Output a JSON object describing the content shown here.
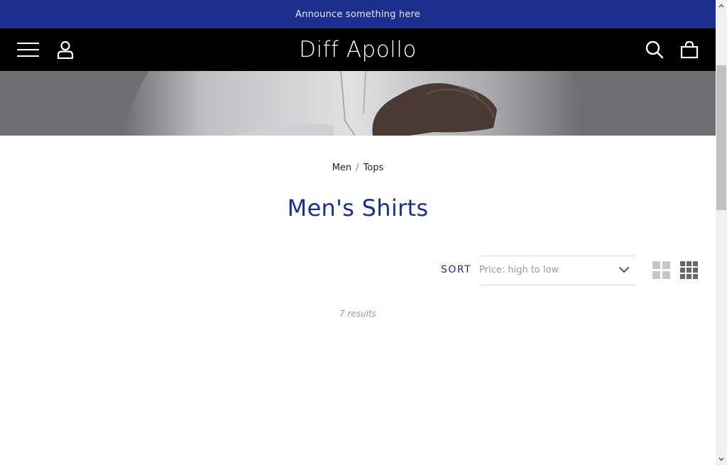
{
  "announcement": "Announce something here",
  "header": {
    "brand": "Diff Apollo",
    "icons": [
      "hamburger-menu-icon",
      "account-icon",
      "search-icon",
      "shopping-bag-icon"
    ]
  },
  "breadcrumb": {
    "items": [
      "Men",
      "Tops"
    ],
    "separator": "/"
  },
  "collection": {
    "title": "Men's Shirts",
    "results": "7 results"
  },
  "sort": {
    "label": "SORT",
    "selected": "Price: high to low"
  },
  "view_options": [
    "grid-2-columns-icon",
    "grid-3-columns-icon"
  ],
  "colors": {
    "accent": "#1c2f8f",
    "header_bg": "#000000",
    "announce_bg": "#1c2f8f"
  }
}
